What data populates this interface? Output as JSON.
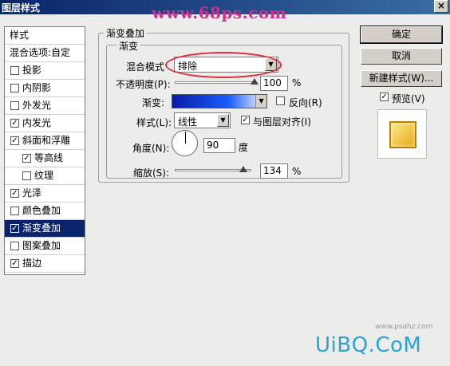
{
  "window": {
    "title": "图层样式",
    "watermark": "www.68ps.com",
    "close": "×"
  },
  "styles_list": {
    "header": "样式",
    "items": [
      {
        "label": "混合选项:自定",
        "checkbox": false,
        "checked": false,
        "sub": false,
        "selected": false
      },
      {
        "label": "投影",
        "checkbox": true,
        "checked": false,
        "sub": false,
        "selected": false
      },
      {
        "label": "内阴影",
        "checkbox": true,
        "checked": false,
        "sub": false,
        "selected": false
      },
      {
        "label": "外发光",
        "checkbox": true,
        "checked": false,
        "sub": false,
        "selected": false
      },
      {
        "label": "内发光",
        "checkbox": true,
        "checked": true,
        "sub": false,
        "selected": false
      },
      {
        "label": "斜面和浮雕",
        "checkbox": true,
        "checked": true,
        "sub": false,
        "selected": false
      },
      {
        "label": "等高线",
        "checkbox": true,
        "checked": true,
        "sub": true,
        "selected": false
      },
      {
        "label": "纹理",
        "checkbox": true,
        "checked": false,
        "sub": true,
        "selected": false
      },
      {
        "label": "光泽",
        "checkbox": true,
        "checked": true,
        "sub": false,
        "selected": false
      },
      {
        "label": "颜色叠加",
        "checkbox": true,
        "checked": false,
        "sub": false,
        "selected": false
      },
      {
        "label": "渐变叠加",
        "checkbox": true,
        "checked": true,
        "sub": false,
        "selected": true
      },
      {
        "label": "图案叠加",
        "checkbox": true,
        "checked": false,
        "sub": false,
        "selected": false
      },
      {
        "label": "描边",
        "checkbox": true,
        "checked": true,
        "sub": false,
        "selected": false
      }
    ]
  },
  "panel": {
    "group_title": "渐变叠加",
    "sub_title": "渐变",
    "blend_mode": {
      "label": "混合模式",
      "value": "排除"
    },
    "opacity": {
      "label": "不透明度(P):",
      "value": "100",
      "unit": "%",
      "level_percent": 100
    },
    "gradient": {
      "label": "渐变:",
      "reverse_label": "反向(R)",
      "reverse_checked": false
    },
    "style": {
      "label": "样式(L):",
      "value": "线性",
      "align_label": "与图层对齐(I)",
      "align_checked": true
    },
    "angle": {
      "label": "角度(N):",
      "value": "90",
      "unit": "度"
    },
    "scale": {
      "label": "缩放(S):",
      "value": "134",
      "unit": "%",
      "level_percent": 134
    }
  },
  "buttons": {
    "ok": "确定",
    "cancel": "取消",
    "new_style": "新建样式(W)...",
    "preview_label": "预览(V)",
    "preview_checked": true
  },
  "footer": {
    "logo": "UiBQ.CoM",
    "site": "www.psahz.com"
  },
  "colors": {
    "titlebar": "#0a246a",
    "selection": "#0a246a",
    "highlight_ellipse": "#e0293a",
    "gradient_start": "#0a1caa",
    "gradient_end": "#ffffff"
  }
}
